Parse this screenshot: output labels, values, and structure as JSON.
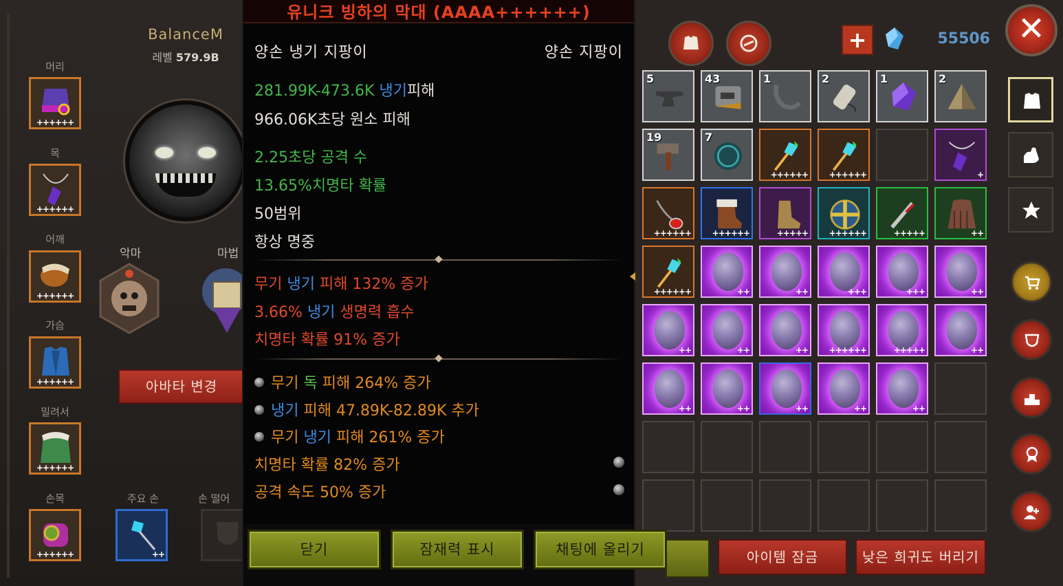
{
  "character": {
    "name": "BalanceM",
    "level_label": "레벨",
    "level_value": "579.9B",
    "avatar_button": "아바타 변경"
  },
  "equipment_slots": [
    {
      "label": "머리",
      "pluses": "++++++"
    },
    {
      "label": "목",
      "pluses": "++++++"
    },
    {
      "label": "어깨",
      "pluses": "++++++"
    },
    {
      "label": "가슴",
      "pluses": "++++++"
    },
    {
      "label": "밀려서",
      "pluses": "++++++"
    },
    {
      "label": "손목",
      "pluses": "++++++"
    }
  ],
  "main_hand": {
    "label": "주요 손",
    "pluses": "++"
  },
  "off_hand": {
    "label": "손 떨어"
  },
  "emblems": [
    {
      "label": "악마"
    },
    {
      "label": "마법"
    }
  ],
  "tooltip": {
    "title": "유니크 빙하의 막대 (AAAA++++++)",
    "item_name": "양손 냉기 지팡이",
    "item_type": "양손 지팡이",
    "damage_range": "281.99K-473.6K",
    "damage_element": "냉기",
    "damage_suffix": "피해",
    "dps": "966.06K초당 원소 피해",
    "attack_speed": "2.25초당 공격 수",
    "crit_chance": "13.65%치명타 확률",
    "range": "50범위",
    "always_hit": "항상 명중",
    "stats_red": [
      {
        "a": "무기 ",
        "b": "냉기",
        "c": " 피해 132% 증가"
      },
      {
        "a": "3.66% ",
        "b": "냉기",
        "c": " 생명력 흡수"
      },
      {
        "a": "치명타 확률 91% 증가",
        "b": "",
        "c": ""
      }
    ],
    "stats_orange": [
      {
        "a": "무기 ",
        "b": "독",
        "c": " 피해 264% 증가"
      },
      {
        "a": "",
        "b": "냉기",
        "c": " 피해 47.89K-82.89K 추가"
      },
      {
        "a": "무기 ",
        "b": "냉기",
        "c": " 피해 261% 증가"
      },
      {
        "a": "치명타 확률 82% 증가",
        "b": "",
        "c": ""
      },
      {
        "a": "공격 속도 50% 증가",
        "b": "",
        "c": ""
      }
    ],
    "buttons": {
      "close": "닫기",
      "show_potential": "잠재력 표시",
      "post_chat": "채팅에 올리기"
    }
  },
  "inventory": {
    "gem_count": "55506",
    "add_label": "+",
    "close_label": "✕",
    "lock_button": "아이템 잠금",
    "discard_button": "낮은 희귀도 버리기",
    "rows": [
      [
        {
          "kind": "mat",
          "count": "5",
          "icon": "anvil-icon"
        },
        {
          "kind": "mat",
          "count": "43",
          "icon": "metal-plate-icon"
        },
        {
          "kind": "mat",
          "count": "1",
          "icon": "hook-icon"
        },
        {
          "kind": "mat",
          "count": "2",
          "icon": "thread-spool-icon"
        },
        {
          "kind": "mat",
          "count": "1",
          "icon": "crystal-icon"
        },
        {
          "kind": "mat",
          "count": "2",
          "icon": "pyramid-icon"
        }
      ],
      [
        {
          "kind": "mat",
          "count": "19",
          "icon": "hammer-icon"
        },
        {
          "kind": "mat",
          "count": "7",
          "icon": "orb-icon"
        },
        {
          "kind": "orange",
          "pl": "++++++",
          "icon": "ice-staff-icon"
        },
        {
          "kind": "orange",
          "pl": "++++++",
          "icon": "ice-staff-icon"
        },
        {
          "kind": "empty"
        },
        {
          "kind": "purple",
          "pl": "+",
          "icon": "feather-amulet-icon"
        }
      ],
      [
        {
          "kind": "orange",
          "pl": "++++++",
          "icon": "ruby-necklace-icon"
        },
        {
          "kind": "blue",
          "pl": "++++++",
          "icon": "fur-boots-icon"
        },
        {
          "kind": "purple",
          "pl": "+++++",
          "icon": "leather-boots-icon"
        },
        {
          "kind": "cyan",
          "pl": "++++++",
          "icon": "round-shield-icon"
        },
        {
          "kind": "green",
          "pl": "+++++",
          "icon": "dagger-icon"
        },
        {
          "kind": "green",
          "pl": "++",
          "icon": "cloak-icon"
        }
      ],
      [
        {
          "kind": "orange",
          "pl": "++++++",
          "icon": "ice-staff-icon"
        },
        {
          "kind": "egg",
          "pl": "++",
          "icon": "egg-icon"
        },
        {
          "kind": "egg",
          "pl": "++",
          "icon": "egg-icon"
        },
        {
          "kind": "egg",
          "pl": "+++",
          "icon": "egg-icon"
        },
        {
          "kind": "egg",
          "pl": "+++",
          "icon": "egg-icon"
        },
        {
          "kind": "egg",
          "pl": "++",
          "icon": "egg-icon"
        }
      ],
      [
        {
          "kind": "egg",
          "pl": "++",
          "icon": "egg-icon"
        },
        {
          "kind": "egg",
          "pl": "++",
          "icon": "egg-icon"
        },
        {
          "kind": "egg",
          "pl": "++",
          "icon": "egg-icon"
        },
        {
          "kind": "egg",
          "pl": "++++++",
          "icon": "egg-icon"
        },
        {
          "kind": "egg",
          "pl": "+++++",
          "icon": "egg-icon"
        },
        {
          "kind": "egg",
          "pl": "++",
          "icon": "egg-icon"
        }
      ],
      [
        {
          "kind": "egg",
          "pl": "++",
          "icon": "egg-icon"
        },
        {
          "kind": "egg",
          "pl": "++",
          "icon": "egg-icon"
        },
        {
          "kind": "egg-blue",
          "pl": "++",
          "icon": "egg-icon"
        },
        {
          "kind": "egg",
          "pl": "++",
          "icon": "egg-icon"
        },
        {
          "kind": "egg",
          "pl": "++",
          "icon": "egg-icon"
        },
        {
          "kind": "empty"
        }
      ],
      [
        {
          "kind": "empty"
        },
        {
          "kind": "empty"
        },
        {
          "kind": "empty"
        },
        {
          "kind": "empty"
        },
        {
          "kind": "empty"
        },
        {
          "kind": "empty"
        }
      ],
      [
        {
          "kind": "empty"
        },
        {
          "kind": "empty"
        },
        {
          "kind": "empty"
        },
        {
          "kind": "empty"
        },
        {
          "kind": "empty"
        },
        {
          "kind": "empty"
        }
      ]
    ]
  },
  "side_tabs": [
    "armor-tab-icon",
    "strength-tab-icon",
    "favorite-tab-icon"
  ],
  "side_buttons": [
    "shop-cart-icon",
    "guild-shield-icon",
    "ranking-podium-icon",
    "achievement-badge-icon",
    "add-friend-icon"
  ],
  "colors": {
    "legendary_orange": "#c8772a",
    "unique_red": "#e5411e",
    "cold_blue": "#3d8be0",
    "gem_blue": "#5f96c8"
  }
}
